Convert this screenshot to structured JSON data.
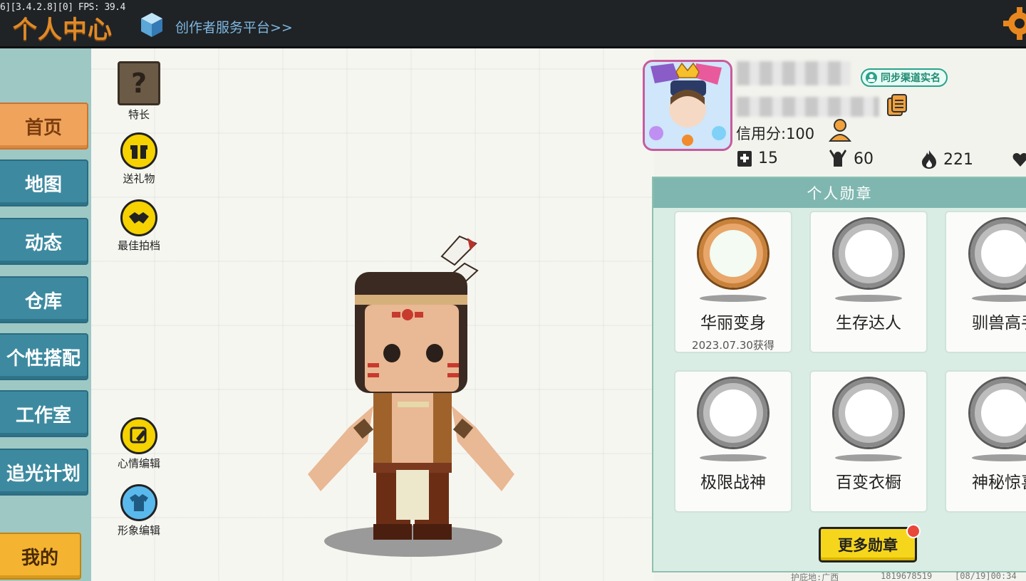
{
  "debug_text": "6][3.4.2.8][0] FPS: 39.4",
  "header": {
    "title": "个人中心",
    "creator_link": "创作者服务平台>>",
    "settings_icon": "gear-icon"
  },
  "nav": {
    "items": [
      "首页",
      "地图",
      "动态",
      "仓库",
      "个性搭配",
      "工作室",
      "追光计划"
    ],
    "active": "首页",
    "bottom": "我的"
  },
  "actions": {
    "talent": "特长",
    "gift": "送礼物",
    "partner": "最佳拍档",
    "mood": "心情编辑",
    "appearance": "形象编辑"
  },
  "profile": {
    "sync_badge": "同步渠道实名",
    "credit": "信用分:100",
    "stats": {
      "posts": "15",
      "fans": "60",
      "popularity": "221"
    }
  },
  "badges": {
    "title": "个人勋章",
    "items": [
      {
        "name": "华丽变身",
        "date": "2023.07.30获得"
      },
      {
        "name": "生存达人",
        "date": ""
      },
      {
        "name": "驯兽高手",
        "date": ""
      },
      {
        "name": "极限战神",
        "date": ""
      },
      {
        "name": "百变衣橱",
        "date": ""
      },
      {
        "name": "神秘惊喜",
        "date": ""
      }
    ],
    "more_button": "更多勋章"
  },
  "footer": {
    "left": "护庇地:广西",
    "id": "1819678519",
    "time": "[08/19]00:34"
  },
  "colors": {
    "nav_blue": "#3d8aa0",
    "nav_active": "#f0a35b",
    "accent_yellow": "#f6d61c",
    "title_orange": "#e08a28"
  }
}
